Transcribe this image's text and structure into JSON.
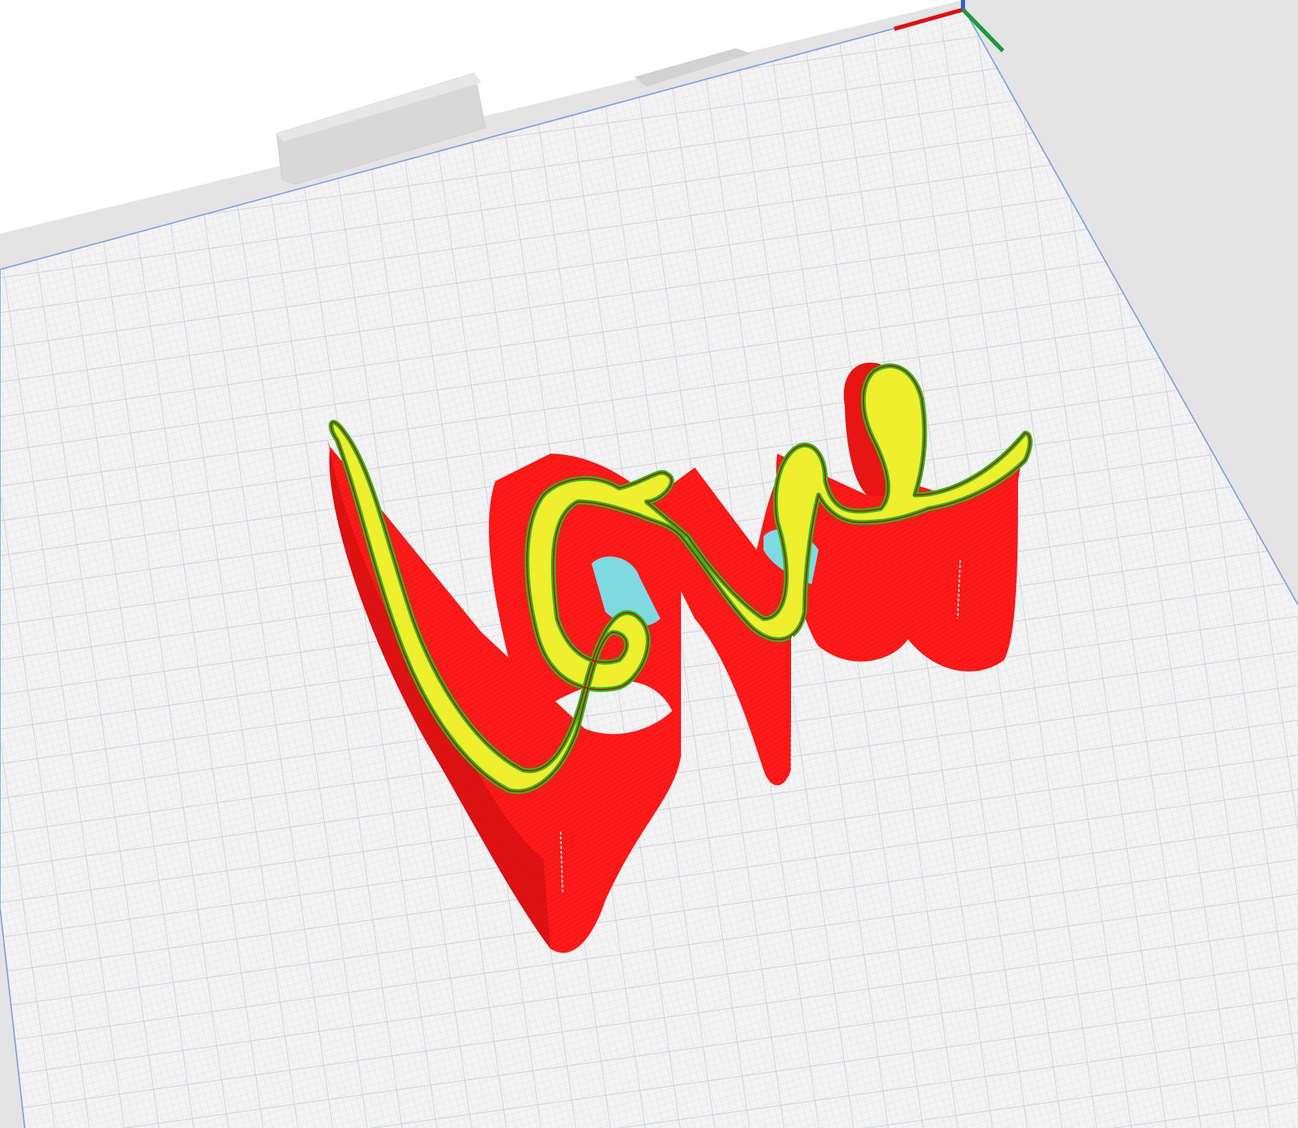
{
  "scene": {
    "view": "layer-preview",
    "model": "love",
    "background_color": "#ffffff",
    "plate_border_color": "#e3e3e3",
    "plate_surface_color": "#f1f1f1",
    "grid_color": "#c9cdd4",
    "plate_edge_color": "#7fa6dc",
    "feature_colors": {
      "outer_wall": "#ff1a1a",
      "inner_wall": "#17c417",
      "top_surface": "#efef2e",
      "support": "#7fd9e0"
    },
    "axis_colors": {
      "x": "#e01010",
      "y": "#1a9a3a",
      "z": "#2a62d6"
    }
  }
}
